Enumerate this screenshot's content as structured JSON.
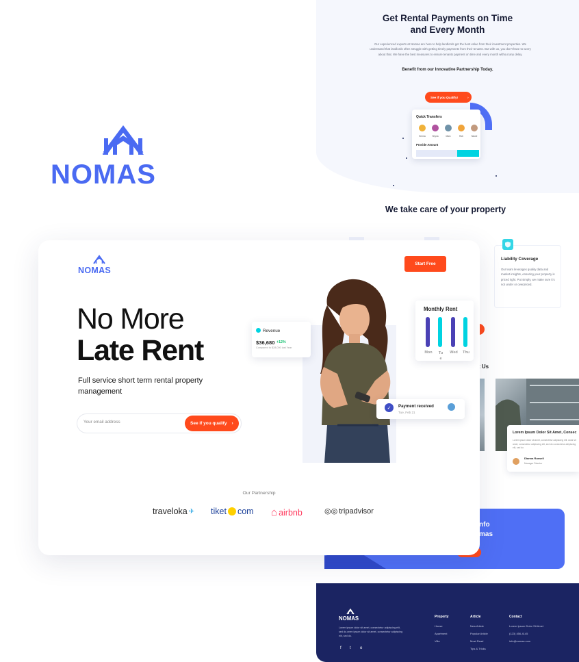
{
  "colors": {
    "brand_blue": "#4a6af2",
    "accent_orange": "#ff4a1c",
    "cyan": "#00d3e1",
    "navy": "#1b2462",
    "bar_purple": "#4a41b5"
  },
  "top_section": {
    "title_line1": "Get Rental Payments on Time",
    "title_line2": "and Every Month",
    "description": "Our experienced experts at Nomas are here to help landlords get the best value from their investment properties. We understand that landlords often struggle with getting timely payments from their tenants. But with us, you don't have to worry about that. We have the best measures to ensure tenants payment on time and every month without any delay.",
    "benefit": "Benefit from our Innovative Partnership Today.",
    "qualify_button": "See if you Qualify!",
    "quick_transfers": {
      "title": "Quick Transfers",
      "people": [
        "Emma",
        "Shyna",
        "Marc",
        "Rob",
        "Nicole"
      ],
      "amount_label": "Provide Amount"
    }
  },
  "brand": {
    "name": "NOMAS"
  },
  "care_title": "We take care of your property",
  "feature": {
    "icon": "shield-icon",
    "title": "Liability Coverage",
    "description": "Our team leverages quality data and market insights, ensuring your property is priced right. Put simply, we make sure it's not under or overpriced."
  },
  "about_fragment": "t Us",
  "blog": {
    "title": "Lorem Ipsum Dolor Sit Amet, Consec",
    "description": "Lorem ipsum dolor sit amet, consectetur adipiscing elit. dolor sit amet, consectetur adipiscing elit, sed do consectetur adipiscing elit, sed do",
    "author": "Dianna Russell",
    "role": "Manager Director"
  },
  "cta": {
    "line1": "nfo",
    "line2": "mas"
  },
  "footer": {
    "logo": "NOMAS",
    "description": "Lorem ipsum dolor sit amet, consectetur adipiscing elit, sed do.orem ipsum dolor sit amet, consectetur adipiscing elit, sed do.",
    "columns": [
      {
        "heading": "Property",
        "links": [
          "House",
          "Apartment",
          "Villa"
        ]
      },
      {
        "heading": "Article",
        "links": [
          "New Article",
          "Popular Article",
          "Most Read",
          "Tips & Tricks"
        ]
      },
      {
        "heading": "Contact",
        "links": [
          "Lorem Ipsum Dolor Sit Amet",
          "(123) 456-4145",
          "info@nomas.com"
        ]
      }
    ],
    "social": [
      "f",
      "t",
      "o"
    ]
  },
  "hero": {
    "logo": "NOMAS",
    "start_free": "Start Free",
    "headline_line1": "No More",
    "headline_line2": "Late Rent",
    "subtitle": "Full service short term rental property management",
    "email_placeholder": "Your email address",
    "qualify_button": "See if you qualify",
    "revenue": {
      "label": "Revenue",
      "value": "$36,680",
      "change": "+12%",
      "compare": "Compared to $28,000 last Year"
    },
    "monthly_rent": {
      "title": "Monthly Rent",
      "days": [
        "Mon",
        "Tu\ne",
        "Wed",
        "Thu"
      ]
    },
    "payment": {
      "title": "Payment received",
      "date": "Tue, Feb 21"
    },
    "partnership_label": "Our Partnership",
    "partners": [
      "traveloka",
      "tiket",
      "com",
      "airbnb",
      "tripadvisor"
    ]
  }
}
